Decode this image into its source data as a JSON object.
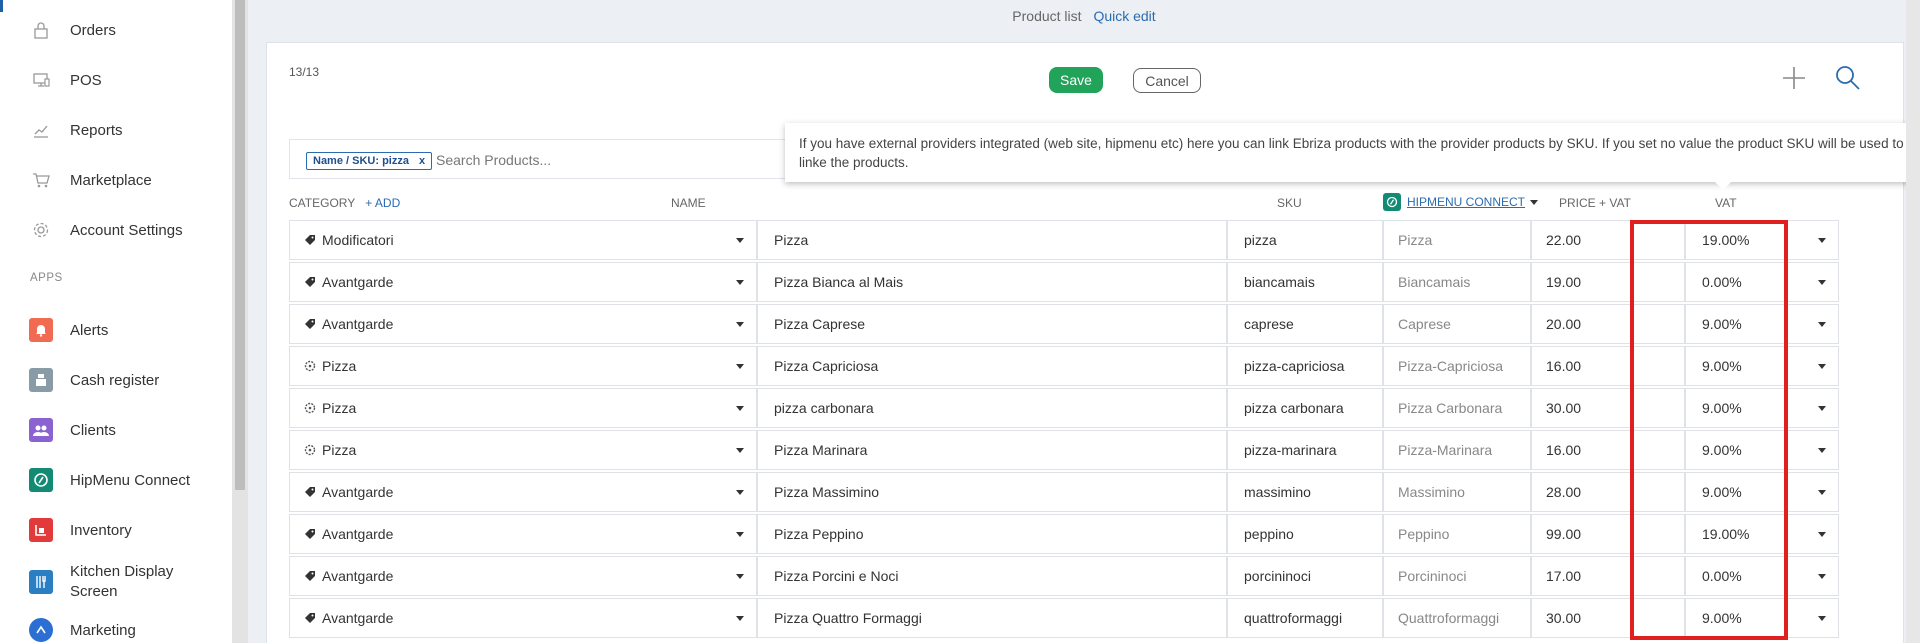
{
  "sidebar": {
    "nav": [
      {
        "label": "Orders",
        "icon": "lock-icon"
      },
      {
        "label": "POS",
        "icon": "monitor-icon"
      },
      {
        "label": "Reports",
        "icon": "chart-icon"
      },
      {
        "label": "Marketplace",
        "icon": "cart-icon"
      },
      {
        "label": "Account Settings",
        "icon": "gear-icon"
      }
    ],
    "apps_header": "APPS",
    "apps": [
      {
        "label": "Alerts",
        "icon": "bell-icon",
        "color": "#f16a52"
      },
      {
        "label": "Cash register",
        "icon": "cash-register-icon",
        "color": "#8a9ba8"
      },
      {
        "label": "Clients",
        "icon": "clients-icon",
        "color": "#8b63d1"
      },
      {
        "label": "HipMenu Connect",
        "icon": "hipmenu-icon",
        "color": "#138a74"
      },
      {
        "label": "Inventory",
        "icon": "inventory-icon",
        "color": "#e23a3a"
      },
      {
        "label": "Kitchen Display Screen",
        "icon": "kitchen-icon",
        "color": "#2a7fc4"
      },
      {
        "label": "Marketing",
        "icon": "marketing-icon",
        "color": "#2a6fd1"
      }
    ]
  },
  "breadcrumb": {
    "section": "Product list",
    "current": "Quick edit"
  },
  "toolbar": {
    "counter": "13/13",
    "save_label": "Save",
    "cancel_label": "Cancel"
  },
  "search": {
    "chip_label": "Name / SKU: pizza",
    "chip_close": "x",
    "placeholder": "Search Products..."
  },
  "tooltip": {
    "text": "If you have external providers integrated (web site, hipmenu etc) here you can link Ebriza products with the provider products by SKU. If you set no value the product SKU will be used to linke the products."
  },
  "columns": {
    "category": "CATEGORY",
    "add": "+ ADD",
    "name": "NAME",
    "sku": "SKU",
    "hipmenu": "HIPMENU CONNECT",
    "price": "PRICE + VAT",
    "vat": "VAT"
  },
  "colors": {
    "accent": "#2b6cb0",
    "save": "#21a35a",
    "highlight": "#e0201f"
  },
  "rows": [
    {
      "category": "Modificatori",
      "cat_icon": "tag-icon",
      "name": "Pizza",
      "sku": "pizza",
      "hipmenu": "Pizza",
      "price": "22.00",
      "vat": "19.00%"
    },
    {
      "category": "Avantgarde",
      "cat_icon": "tag-icon",
      "name": "Pizza Bianca al Mais",
      "sku": "biancamais",
      "hipmenu": "Biancamais",
      "price": "19.00",
      "vat": "0.00%"
    },
    {
      "category": "Avantgarde",
      "cat_icon": "tag-icon",
      "name": "Pizza Caprese",
      "sku": "caprese",
      "hipmenu": "Caprese",
      "price": "20.00",
      "vat": "9.00%"
    },
    {
      "category": "Pizza",
      "cat_icon": "pizza-icon",
      "name": "Pizza Capriciosa",
      "sku": "pizza-capriciosa",
      "hipmenu": "Pizza-Capriciosa",
      "price": "16.00",
      "vat": "9.00%"
    },
    {
      "category": "Pizza",
      "cat_icon": "pizza-icon",
      "name": "pizza carbonara",
      "sku": "pizza carbonara",
      "hipmenu": "Pizza Carbonara",
      "price": "30.00",
      "vat": "9.00%"
    },
    {
      "category": "Pizza",
      "cat_icon": "pizza-icon",
      "name": "Pizza Marinara",
      "sku": "pizza-marinara",
      "hipmenu": "Pizza-Marinara",
      "price": "16.00",
      "vat": "9.00%"
    },
    {
      "category": "Avantgarde",
      "cat_icon": "tag-icon",
      "name": "Pizza Massimino",
      "sku": "massimino",
      "hipmenu": "Massimino",
      "price": "28.00",
      "vat": "9.00%"
    },
    {
      "category": "Avantgarde",
      "cat_icon": "tag-icon",
      "name": "Pizza Peppino",
      "sku": "peppino",
      "hipmenu": "Peppino",
      "price": "99.00",
      "vat": "19.00%"
    },
    {
      "category": "Avantgarde",
      "cat_icon": "tag-icon",
      "name": "Pizza Porcini e Noci",
      "sku": "porcininoci",
      "hipmenu": "Porcininoci",
      "price": "17.00",
      "vat": "0.00%"
    },
    {
      "category": "Avantgarde",
      "cat_icon": "tag-icon",
      "name": "Pizza Quattro Formaggi",
      "sku": "quattroformaggi",
      "hipmenu": "Quattroformaggi",
      "price": "30.00",
      "vat": "9.00%"
    }
  ]
}
